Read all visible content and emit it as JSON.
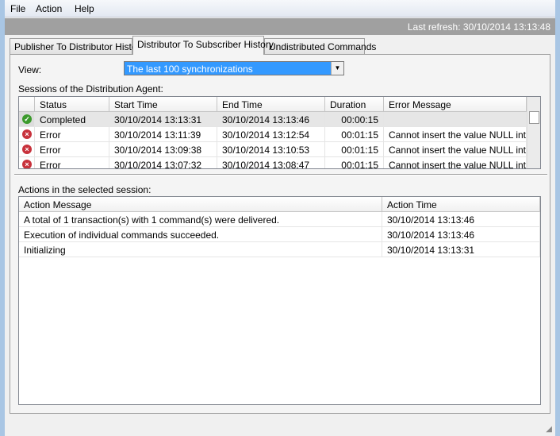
{
  "menu": [
    "File",
    "Action",
    "Help"
  ],
  "last_refresh": "Last refresh: 30/10/2014 13:13:48",
  "tabs": [
    "Publisher To Distributor History",
    "Distributor To Subscriber History",
    "Undistributed Commands"
  ],
  "view": {
    "label": "View:",
    "value": "The last 100 synchronizations"
  },
  "sessions": {
    "label": "Sessions of the Distribution Agent:",
    "columns": [
      "Status",
      "Start Time",
      "End Time",
      "Duration",
      "Error Message"
    ],
    "rows": [
      {
        "icon": "success-icon",
        "status": "Completed",
        "start": "30/10/2014 13:13:31",
        "end": "30/10/2014 13:13:46",
        "duration": "00:00:15",
        "error": ""
      },
      {
        "icon": "error-icon",
        "status": "Error",
        "start": "30/10/2014 13:11:39",
        "end": "30/10/2014 13:12:54",
        "duration": "00:01:15",
        "error": "Cannot insert the value NULL int..."
      },
      {
        "icon": "error-icon",
        "status": "Error",
        "start": "30/10/2014 13:09:38",
        "end": "30/10/2014 13:10:53",
        "duration": "00:01:15",
        "error": "Cannot insert the value NULL int..."
      },
      {
        "icon": "error-icon",
        "status": "Error",
        "start": "30/10/2014 13:07:32",
        "end": "30/10/2014 13:08:47",
        "duration": "00:01:15",
        "error": "Cannot insert the value NULL int..."
      }
    ]
  },
  "actions": {
    "label": "Actions in the selected session:",
    "columns": [
      "Action Message",
      "Action Time"
    ],
    "rows": [
      {
        "message": "A total of 1 transaction(s) with 1 command(s) were delivered.",
        "time": "30/10/2014 13:13:46"
      },
      {
        "message": "Execution of individual commands succeeded.",
        "time": "30/10/2014 13:13:46"
      },
      {
        "message": "Initializing",
        "time": "30/10/2014 13:13:31"
      }
    ]
  },
  "colors": {
    "selection": "#3399ff",
    "success": "#3c9a2c",
    "error": "#c8323c",
    "refresh_bar": "#a0a0a0"
  }
}
